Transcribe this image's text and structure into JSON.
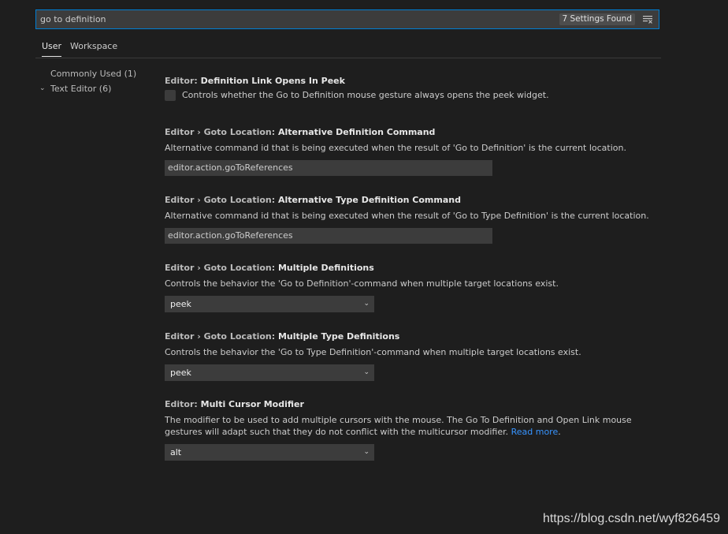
{
  "search": {
    "value": "go to definition",
    "found": "7 Settings Found"
  },
  "tabs": [
    {
      "label": "User"
    },
    {
      "label": "Workspace"
    }
  ],
  "toc": [
    {
      "label": "Commonly Used (1)"
    },
    {
      "label": "Text Editor (6)"
    }
  ],
  "settings": [
    {
      "category": "Editor: ",
      "name": "Definition Link Opens In Peek",
      "description": "Controls whether the Go to Definition mouse gesture always opens the peek widget."
    },
    {
      "category": "Editor › Goto Location: ",
      "name": "Alternative Definition Command",
      "description": "Alternative command id that is being executed when the result of 'Go to Definition' is the current location.",
      "value": "editor.action.goToReferences"
    },
    {
      "category": "Editor › Goto Location: ",
      "name": "Alternative Type Definition Command",
      "description": "Alternative command id that is being executed when the result of 'Go to Type Definition' is the current location.",
      "value": "editor.action.goToReferences"
    },
    {
      "category": "Editor › Goto Location: ",
      "name": "Multiple Definitions",
      "description": "Controls the behavior the 'Go to Definition'-command when multiple target locations exist.",
      "value": "peek"
    },
    {
      "category": "Editor › Goto Location: ",
      "name": "Multiple Type Definitions",
      "description": "Controls the behavior the 'Go to Type Definition'-command when multiple target locations exist.",
      "value": "peek"
    },
    {
      "category": "Editor: ",
      "name": "Multi Cursor Modifier",
      "description": "The modifier to be used to add multiple cursors with the mouse. The Go To Definition and Open Link mouse gestures will adapt such that they do not conflict with the multicursor modifier.",
      "link": "Read more",
      "trailing": ".",
      "value": "alt"
    }
  ],
  "watermark": "https://blog.csdn.net/wyf826459",
  "colors": {
    "accent": "#007fd4",
    "link": "#3794ff",
    "background": "#1e1e1e",
    "input": "#3c3c3c"
  }
}
